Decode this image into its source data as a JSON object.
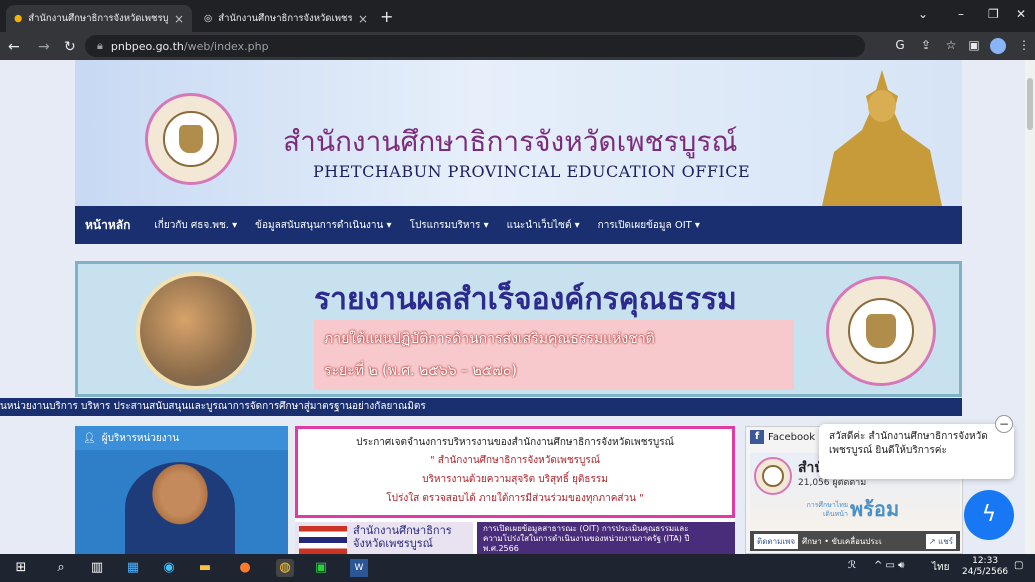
{
  "browser": {
    "tabs": [
      {
        "title": "สำนักงานศึกษาธิการจังหวัดเพชรบูรณ์",
        "active": true
      },
      {
        "title": "สำนักงานศึกษาธิการจังหวัดเพชรบูรณ์",
        "active": false
      }
    ],
    "new_tab": "+",
    "url_host": "pnbpeo.go.th",
    "url_path": "/web/index.php"
  },
  "header": {
    "title_th": "สำนักงานศึกษาธิการจังหวัดเพชรบูรณ์",
    "title_en": "PHETCHABUN PROVINCIAL EDUCATION OFFICE"
  },
  "menu": [
    "หน้าหลัก",
    "เกี่ยวกับ ศธจ.พช. ▾",
    "ข้อมูลสนับสนุนการดำเนินงาน ▾",
    "โปรแกรมบริหาร ▾",
    "แนะนำเว็บไซต์ ▾",
    "การเปิดเผยข้อมูล OIT ▾"
  ],
  "banner": {
    "title": "รายงานผลสำเร็จองค์กรคุณธรรม",
    "sub1": "ภายใต้แผนปฏิบัติการด้านการส่งเสริมคุณธรรมแห่งชาติ",
    "sub2": "ระยะที่ ๒ (พ.ศ. ๒๕๖๖ – ๒๕๗๐)"
  },
  "ticker": "นหน่วยงานบริการ บริหาร ประสานสนับสนุนและบูรณาการจัดการศึกษาสู่มาตรฐานอย่างกัลยาณมิตร",
  "left_panel": {
    "title": "ผู้บริหารหน่วยงาน"
  },
  "announcement": {
    "l1": "ประกาศเจตจำนงการบริหารงานของสำนักงานศึกษาธิการจังหวัดเพชรบูรณ์",
    "l2": "\" สำนักงานศึกษาธิการจังหวัดเพชรบูรณ์",
    "l3": "บริหารงานด้วยความสุจริต บริสุทธิ์ ยุติธรรม",
    "l4": "โปร่งใส ตรวจสอบได้ ภายใต้การมีส่วนร่วมของทุกภาคส่วน \""
  },
  "cards": {
    "c1": "สำนักงานศึกษาธิการ จังหวัดเพชรบูรณ์",
    "c2": "การเปิดเผยข้อมูลสาธารณะ (OIT) การประเมินคุณธรรมและความโปร่งใสในการดำเนินงานของหน่วยงานภาครัฐ (ITA) ปี พ.ศ.2566"
  },
  "facebook": {
    "header": "Facebook",
    "name": "สำนั",
    "followers": "21,056 ผู้ติดตาม",
    "big": "พร้อม",
    "small": "การศึกษาไทย เดินหน้า",
    "follow": "ติดตามเพจ",
    "drive": "ศึกษา • ขับเคลื่อนประเ",
    "share": "↗ แชร์"
  },
  "chat": {
    "message": "สวัสดีค่ะ สำนักงานศึกษาธิการจังหวัดเพชรบูรณ์ ยินดีให้บริการค่ะ",
    "close": "−"
  },
  "taskbar": {
    "lang": "ไทย",
    "time": "12:33",
    "date": "24/5/2566"
  }
}
